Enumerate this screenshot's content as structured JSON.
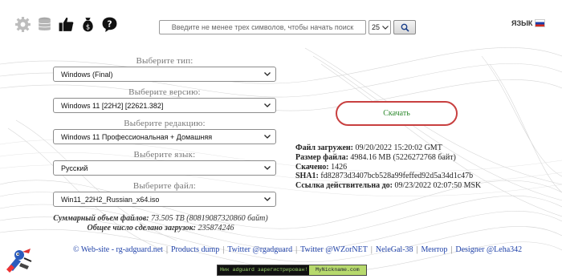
{
  "toolbar": {
    "icons": [
      "gear-icon",
      "database-icon",
      "thumbs-up-icon",
      "money-bag-icon",
      "help-icon"
    ],
    "search_placeholder": "Введите не менее трех символов, чтобы начать поиск",
    "results_count": "25",
    "language_label": "ЯЗЫК"
  },
  "form": {
    "type": {
      "label": "Выберите тип:",
      "value": "Windows (Final)"
    },
    "version": {
      "label": "Выберите версию:",
      "value": "Windows 11 [22H2] [22621.382]"
    },
    "edition": {
      "label": "Выберите редакцию:",
      "value": "Windows 11 Профессиональная + Домашняя"
    },
    "language": {
      "label": "Выберите язык:",
      "value": "Русский"
    },
    "file": {
      "label": "Выберите файл:",
      "value": "Win11_22H2_Russian_x64.iso"
    }
  },
  "totals": {
    "size_label": "Суммарный объем файлов:",
    "size_value": "73.505 TB (80819087320860 байт)",
    "downloads_label": "Общее число сделано загрузок:",
    "downloads_value": "235874246"
  },
  "download": {
    "button_label": "Скачать",
    "info": [
      {
        "label": "Файл загружен:",
        "value": "09/20/2022 15:20:02 GMT"
      },
      {
        "label": "Размер файла:",
        "value": "4984.16 MB (5226272768 байт)"
      },
      {
        "label": "Скачено:",
        "value": "1426"
      },
      {
        "label": "SHA1:",
        "value": "fd82873d3407bcb528a99feffed92d5a34d1c47b"
      },
      {
        "label": "Ссылка действительна до:",
        "value": "09/23/2022 02:07:50 MSK"
      }
    ]
  },
  "footer": {
    "links": [
      "© Web-site - rg-adguard.net",
      "Products dump",
      "Twitter @rgadguard",
      "Twitter @WZorNET",
      "NeleGal-38",
      "Ментор",
      "Designer @Leha342"
    ],
    "banner_left": "Ник adguard зарегистрирован!",
    "banner_right": "MyNickname.com"
  },
  "colors": {
    "download_border": "#c84040",
    "download_text": "#2e8a2e",
    "link": "#2244aa"
  }
}
